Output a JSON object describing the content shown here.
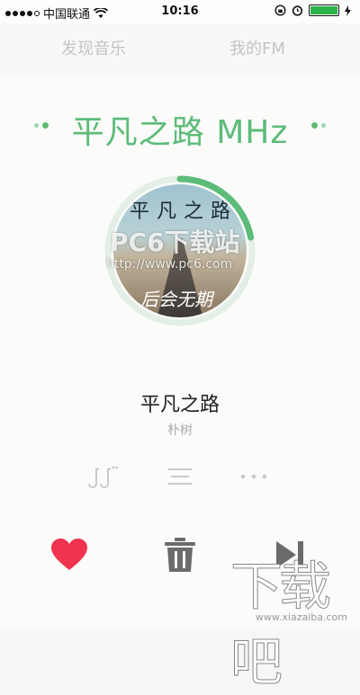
{
  "status_bar": {
    "carrier": "中国联通",
    "time": "10:16"
  },
  "tabs": [
    {
      "label": "发现音乐"
    },
    {
      "label": "我的FM"
    }
  ],
  "player": {
    "station_name": "平凡之路 MHz",
    "cover": {
      "title": "平凡之路",
      "script": "后会无期"
    },
    "progress": 0.22,
    "song_title": "平凡之路",
    "artist": "朴树",
    "accent_color": "#5cbc78",
    "heart_color": "#f0334f",
    "control_color": "#6b6b6b",
    "icons": [
      "music-notes-icon",
      "list-icon",
      "more-icon",
      "heart-icon",
      "trash-icon",
      "next-icon"
    ]
  },
  "watermarks": {
    "overlay_name": "PC6下载站",
    "overlay_url": "http://www.pc6.com",
    "site_name": "下载吧",
    "site_url": "www.xiazaiba.com"
  }
}
